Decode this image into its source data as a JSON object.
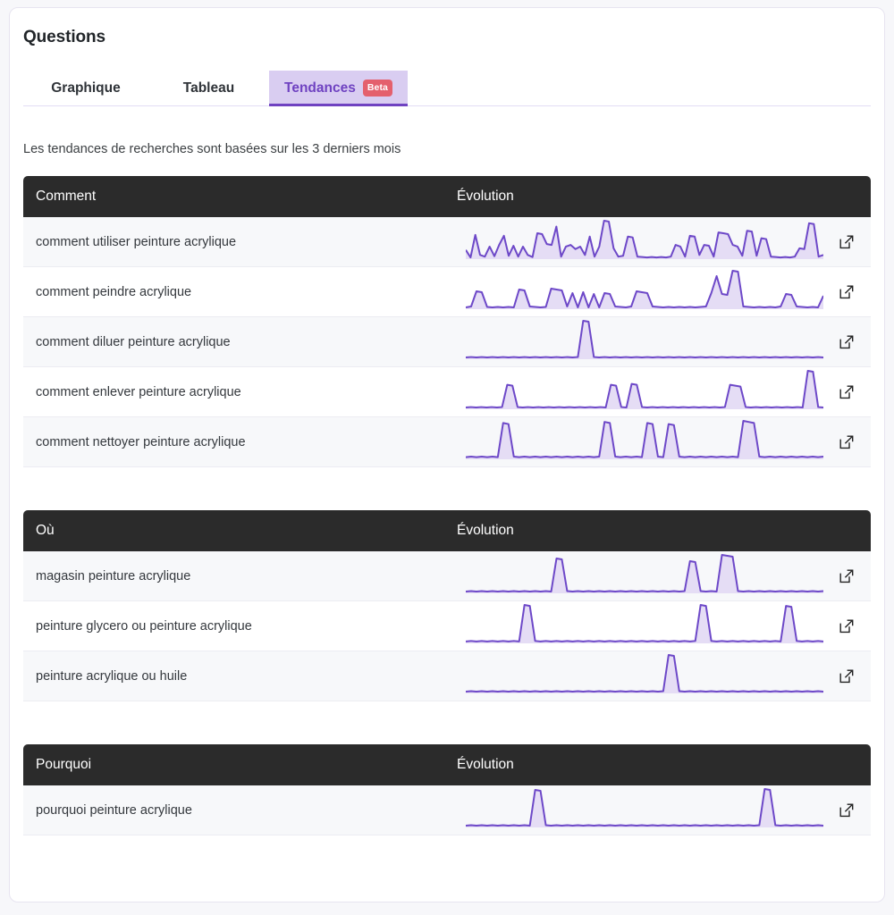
{
  "card": {
    "title": "Questions"
  },
  "tabs": [
    {
      "label": "Graphique",
      "active": false,
      "badge": null
    },
    {
      "label": "Tableau",
      "active": false,
      "badge": null
    },
    {
      "label": "Tendances",
      "active": true,
      "badge": "Beta"
    }
  ],
  "subtitle": "Les tendances de recherches sont basées sur les 3 derniers mois",
  "colors": {
    "accent": "#6f42c1",
    "spark_stroke": "#6d48c8",
    "spark_fill": "#e5ddf5",
    "header_bg": "#2b2b2b",
    "tab_active_bg": "#d9cdf1",
    "badge_bg": "#e4606d",
    "row_alt_bg": "#f7f8fa",
    "card_border": "#e7e4f0"
  },
  "icons": {
    "external_link": "external-link-icon"
  },
  "evolution_header": "Évolution",
  "sections": [
    {
      "key": "comment",
      "header": "Comment",
      "rows": [
        {
          "label": "comment utiliser peinture acrylique",
          "action": "external-link-icon",
          "sparkline": [
            22,
            4,
            58,
            10,
            6,
            30,
            7,
            34,
            56,
            8,
            32,
            6,
            30,
            10,
            5,
            62,
            60,
            36,
            34,
            78,
            6,
            30,
            34,
            24,
            30,
            10,
            54,
            6,
            30,
            92,
            90,
            26,
            6,
            8,
            54,
            52,
            6,
            5,
            4,
            5,
            4,
            5,
            4,
            6,
            34,
            30,
            6,
            56,
            54,
            10,
            34,
            32,
            6,
            64,
            62,
            60,
            34,
            30,
            8,
            68,
            66,
            8,
            50,
            48,
            6,
            5,
            4,
            5,
            4,
            6,
            26,
            24,
            86,
            84,
            6,
            10
          ]
        },
        {
          "label": "comment peindre acrylique",
          "action": "external-link-icon",
          "sparkline": [
            4,
            6,
            40,
            38,
            5,
            4,
            5,
            4,
            5,
            4,
            44,
            42,
            6,
            5,
            4,
            5,
            46,
            44,
            42,
            6,
            36,
            4,
            38,
            4,
            34,
            4,
            36,
            34,
            6,
            5,
            4,
            6,
            40,
            38,
            36,
            6,
            5,
            4,
            5,
            4,
            5,
            4,
            5,
            4,
            5,
            6,
            36,
            74,
            34,
            32,
            86,
            84,
            6,
            5,
            4,
            5,
            4,
            5,
            4,
            6,
            34,
            32,
            6,
            5,
            4,
            5,
            4,
            30
          ]
        },
        {
          "label": "comment diluer peinture acrylique",
          "action": "external-link-icon",
          "sparkline": [
            4,
            5,
            4,
            5,
            4,
            5,
            4,
            5,
            4,
            5,
            4,
            5,
            4,
            5,
            4,
            5,
            4,
            5,
            4,
            5,
            4,
            5,
            88,
            86,
            5,
            4,
            5,
            4,
            5,
            4,
            5,
            4,
            5,
            4,
            5,
            4,
            5,
            4,
            5,
            4,
            5,
            4,
            5,
            4,
            5,
            4,
            5,
            4,
            5,
            4,
            5,
            4,
            5,
            4,
            5,
            4,
            5,
            4,
            5,
            4,
            5,
            4,
            5,
            4,
            5,
            4,
            5,
            4
          ]
        },
        {
          "label": "comment enlever peinture acrylique",
          "action": "external-link-icon",
          "sparkline": [
            4,
            5,
            4,
            5,
            4,
            5,
            4,
            5,
            56,
            54,
            5,
            4,
            5,
            4,
            5,
            4,
            5,
            4,
            5,
            4,
            5,
            4,
            5,
            4,
            5,
            4,
            5,
            4,
            56,
            54,
            5,
            4,
            58,
            56,
            5,
            4,
            5,
            4,
            5,
            4,
            5,
            4,
            5,
            4,
            5,
            4,
            5,
            4,
            5,
            4,
            5,
            56,
            54,
            52,
            5,
            4,
            5,
            4,
            5,
            4,
            5,
            4,
            5,
            4,
            5,
            4,
            88,
            86,
            5,
            4
          ]
        },
        {
          "label": "comment nettoyer peinture acrylique",
          "action": "external-link-icon",
          "sparkline": [
            4,
            5,
            4,
            5,
            4,
            5,
            4,
            68,
            66,
            5,
            4,
            5,
            4,
            5,
            4,
            5,
            4,
            5,
            4,
            5,
            4,
            5,
            4,
            5,
            4,
            5,
            70,
            68,
            5,
            4,
            5,
            4,
            5,
            4,
            68,
            66,
            5,
            4,
            66,
            64,
            5,
            4,
            5,
            4,
            5,
            4,
            5,
            4,
            5,
            4,
            5,
            4,
            72,
            70,
            68,
            5,
            4,
            5,
            4,
            5,
            4,
            5,
            4,
            5,
            4,
            5,
            4,
            5
          ]
        }
      ]
    },
    {
      "key": "ou",
      "header": "Où",
      "rows": [
        {
          "label": "magasin peinture acrylique",
          "action": "external-link-icon",
          "sparkline": [
            4,
            5,
            4,
            5,
            4,
            5,
            4,
            5,
            4,
            5,
            4,
            5,
            4,
            5,
            4,
            5,
            4,
            78,
            76,
            5,
            4,
            5,
            4,
            5,
            4,
            5,
            4,
            5,
            4,
            5,
            4,
            5,
            4,
            5,
            4,
            5,
            4,
            5,
            4,
            5,
            4,
            5,
            72,
            70,
            5,
            4,
            5,
            4,
            86,
            84,
            82,
            5,
            4,
            5,
            4,
            5,
            4,
            5,
            4,
            5,
            4,
            5,
            4,
            5,
            4,
            5,
            4,
            5
          ]
        },
        {
          "label": "peinture glycero ou peinture acrylique",
          "action": "external-link-icon",
          "sparkline": [
            4,
            5,
            4,
            5,
            4,
            5,
            4,
            5,
            4,
            5,
            4,
            80,
            78,
            5,
            4,
            5,
            4,
            5,
            4,
            5,
            4,
            5,
            4,
            5,
            4,
            5,
            4,
            5,
            4,
            5,
            4,
            5,
            4,
            5,
            4,
            5,
            4,
            5,
            4,
            5,
            4,
            5,
            4,
            5,
            80,
            78,
            5,
            4,
            5,
            4,
            5,
            4,
            5,
            4,
            5,
            4,
            5,
            4,
            5,
            4,
            78,
            76,
            5,
            4,
            5,
            4,
            5,
            4
          ]
        },
        {
          "label": "peinture acrylique ou huile",
          "action": "external-link-icon",
          "sparkline": [
            4,
            5,
            4,
            5,
            4,
            5,
            4,
            5,
            4,
            5,
            4,
            5,
            4,
            5,
            4,
            5,
            4,
            5,
            4,
            5,
            4,
            5,
            4,
            5,
            4,
            5,
            4,
            5,
            4,
            5,
            4,
            5,
            4,
            5,
            4,
            5,
            4,
            5,
            86,
            84,
            5,
            4,
            5,
            4,
            5,
            4,
            5,
            4,
            5,
            4,
            5,
            4,
            5,
            4,
            5,
            4,
            5,
            4,
            5,
            4,
            5,
            4,
            5,
            4,
            5,
            4,
            5,
            4
          ]
        }
      ]
    },
    {
      "key": "pourquoi",
      "header": "Pourquoi",
      "rows": [
        {
          "label": "pourquoi peinture acrylique",
          "action": "external-link-icon",
          "sparkline": [
            4,
            5,
            4,
            5,
            4,
            5,
            4,
            5,
            4,
            5,
            4,
            5,
            4,
            84,
            82,
            5,
            4,
            5,
            4,
            5,
            4,
            5,
            4,
            5,
            4,
            5,
            4,
            5,
            4,
            5,
            4,
            5,
            4,
            5,
            4,
            5,
            4,
            5,
            4,
            5,
            4,
            5,
            4,
            5,
            4,
            5,
            4,
            5,
            4,
            5,
            4,
            5,
            4,
            5,
            4,
            5,
            86,
            84,
            5,
            4,
            5,
            4,
            5,
            4,
            5,
            4,
            5,
            4
          ]
        }
      ]
    }
  ]
}
